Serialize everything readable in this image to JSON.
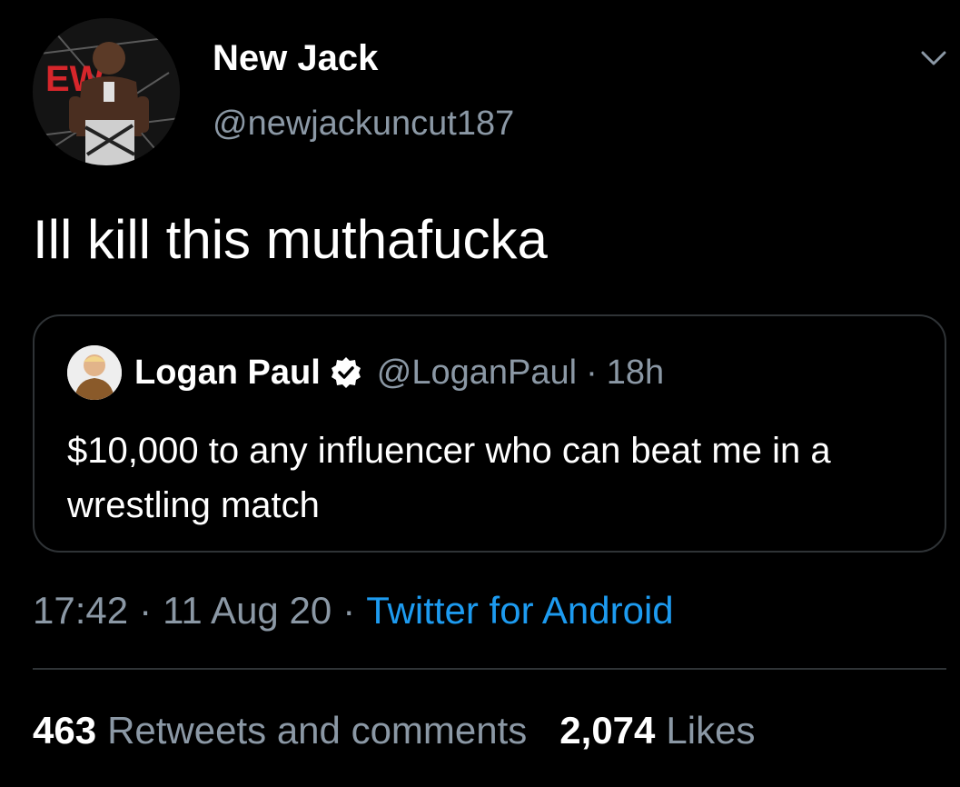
{
  "author": {
    "display_name": "New Jack",
    "handle": "@newjackuncut187",
    "avatar_icon": "wrestler-avatar",
    "avatar_logo_text": "EW"
  },
  "tweet": {
    "text": "Ill kill this muthafucka"
  },
  "quote": {
    "display_name": "Logan Paul",
    "verified_icon": "verified-badge-icon",
    "handle": "@LoganPaul",
    "separator": "·",
    "time": "18h",
    "text": "$10,000 to any influencer who can beat me in a wrestling match"
  },
  "meta": {
    "time": "17:42",
    "separator": "·",
    "date": "11 Aug 20",
    "source": "Twitter for Android"
  },
  "stats": {
    "retweets_count": "463",
    "retweets_label": "Retweets and comments",
    "likes_count": "2,074",
    "likes_label": "Likes"
  },
  "colors": {
    "background": "#000000",
    "primary_text": "#ffffff",
    "secondary_text": "#8b98a5",
    "link": "#1d9bf0",
    "border": "#2f3336",
    "logo_red": "#d6262b"
  },
  "icons": {
    "more": "chevron-down-icon",
    "verified": "verified-badge-icon"
  }
}
